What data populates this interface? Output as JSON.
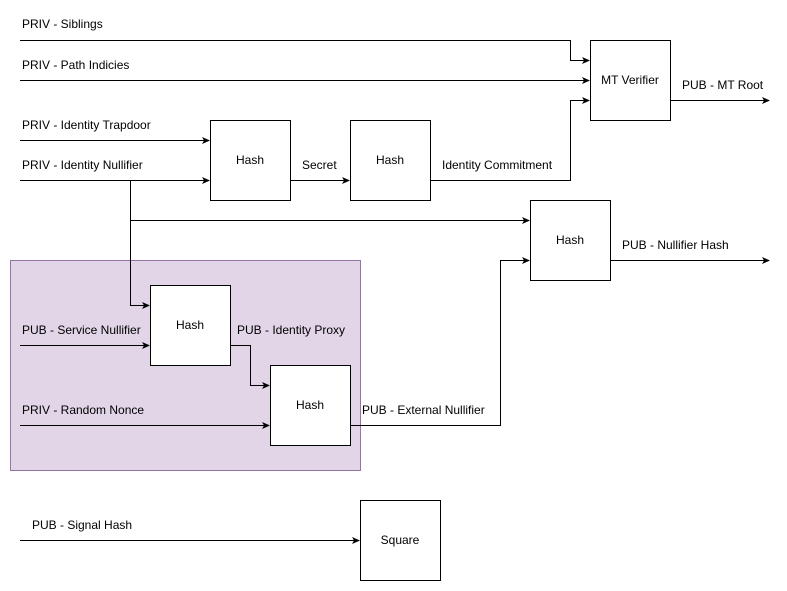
{
  "colors": {
    "group_fill": "#e1d5e7",
    "group_stroke": "#9673a6"
  },
  "boxes": {
    "mt_verifier": "MT Verifier",
    "hash_secret": "Hash",
    "hash_commitment": "Hash",
    "hash_nullifier": "Hash",
    "hash_proxy": "Hash",
    "hash_external": "Hash",
    "square": "Square"
  },
  "labels": {
    "siblings": "PRIV - Siblings",
    "path_indices": "PRIV - Path Indicies",
    "identity_trapdoor": "PRIV - Identity Trapdoor",
    "identity_nullifier": "PRIV - Identity Nullifier",
    "secret": "Secret",
    "identity_commitment": "Identity Commitment",
    "mt_root": "PUB - MT Root",
    "nullifier_hash": "PUB - Nullifier Hash",
    "service_nullifier": "PUB - Service Nullifier",
    "identity_proxy": "PUB - Identity Proxy",
    "random_nonce": "PRIV - Random Nonce",
    "external_nullifier": "PUB - External Nullifier",
    "signal_hash": "PUB - Signal Hash"
  }
}
